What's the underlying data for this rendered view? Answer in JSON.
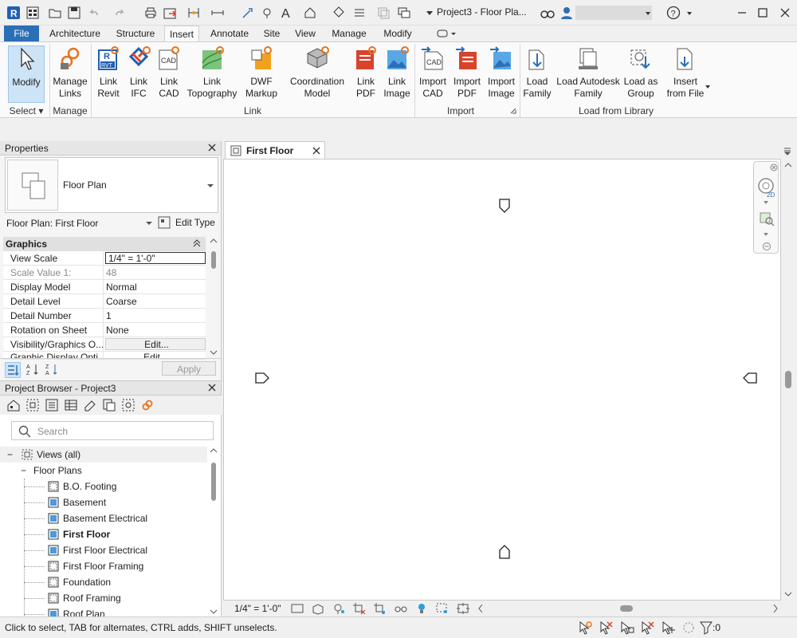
{
  "title": {
    "text": "Project3 - Floor Pla...",
    "help": "?"
  },
  "tabs": [
    {
      "label": "File"
    },
    {
      "label": "Architecture"
    },
    {
      "label": "Structure"
    },
    {
      "label": "Insert"
    },
    {
      "label": "Annotate"
    },
    {
      "label": "Site"
    },
    {
      "label": "View"
    },
    {
      "label": "Manage"
    },
    {
      "label": "Modify"
    }
  ],
  "ribbon": {
    "buttons": [
      {
        "label": "Modify"
      },
      {
        "label": "Manage\nLinks"
      },
      {
        "label": "Link\nRevit"
      },
      {
        "label": "Link\nIFC"
      },
      {
        "label": "Link\nCAD"
      },
      {
        "label": "Link\nTopography"
      },
      {
        "label": "DWF\nMarkup"
      },
      {
        "label": "Coordination\nModel"
      },
      {
        "label": "Link\nPDF"
      },
      {
        "label": "Link\nImage"
      },
      {
        "label": "Import\nCAD"
      },
      {
        "label": "Import\nPDF"
      },
      {
        "label": "Import\nImage"
      },
      {
        "label": "Load\nFamily"
      },
      {
        "label": "Load Autodesk\nFamily"
      },
      {
        "label": "Load as\nGroup"
      },
      {
        "label": "Insert\nfrom File"
      }
    ],
    "panels": [
      {
        "label": "Select"
      },
      {
        "label": "Manage"
      },
      {
        "label": "Link"
      },
      {
        "label": "Import"
      },
      {
        "label": "Load from Library"
      }
    ],
    "icon_text": {
      "rvt": "RVT",
      "cad": "CAD"
    }
  },
  "properties": {
    "title": "Properties",
    "type_name": "Floor Plan",
    "instance": "Floor Plan: First Floor",
    "edit_type": "Edit Type",
    "group": "Graphics",
    "rows": [
      {
        "k": "View Scale",
        "v": "1/4\" = 1'-0\""
      },
      {
        "k": "Scale Value    1:",
        "v": "48"
      },
      {
        "k": "Display Model",
        "v": "Normal"
      },
      {
        "k": "Detail Level",
        "v": "Coarse"
      },
      {
        "k": "Detail Number",
        "v": "1"
      },
      {
        "k": "Rotation on Sheet",
        "v": "None"
      },
      {
        "k": "Visibility/Graphics O...",
        "v": "Edit..."
      },
      {
        "k": "Graphic Display Opti...",
        "v": "Edit..."
      }
    ],
    "apply": "Apply"
  },
  "browser": {
    "title": "Project Browser - Project3",
    "search_placeholder": "Search",
    "views_all": "Views (all)",
    "floor_plans": "Floor Plans",
    "items": [
      {
        "label": "B.O. Footing",
        "filled": false
      },
      {
        "label": "Basement",
        "filled": true
      },
      {
        "label": "Basement Electrical",
        "filled": true
      },
      {
        "label": "First Floor",
        "filled": true,
        "current": true
      },
      {
        "label": "First Floor Electrical",
        "filled": true
      },
      {
        "label": "First Floor Framing",
        "filled": false
      },
      {
        "label": "Foundation",
        "filled": false
      },
      {
        "label": "Roof Framing",
        "filled": false
      },
      {
        "label": "Roof Plan",
        "filled": true
      }
    ]
  },
  "view": {
    "tab": "First Floor",
    "scale": "1/4\" = 1'-0\"",
    "navbar_2d": "2D"
  },
  "status": {
    "hint": "Click to select, TAB for alternates, CTRL adds, SHIFT unselects.",
    "filter_count": ":0"
  }
}
